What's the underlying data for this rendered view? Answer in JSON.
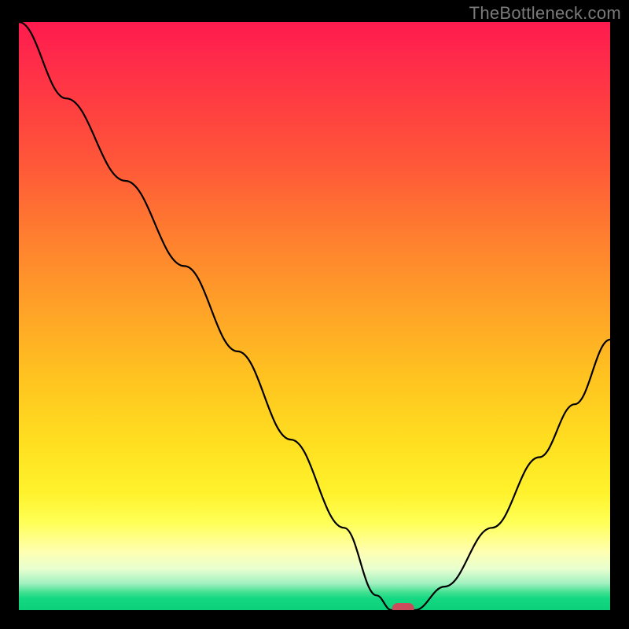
{
  "watermark": "TheBottleneck.com",
  "chart_data": {
    "type": "line",
    "title": "",
    "xlabel": "",
    "ylabel": "",
    "xlim": [
      0,
      100
    ],
    "ylim": [
      0,
      100
    ],
    "series": [
      {
        "name": "bottleneck-curve",
        "x": [
          0,
          8,
          18,
          28,
          37,
          46,
          55,
          60.5,
          63,
          67,
          72,
          80,
          88,
          94,
          100
        ],
        "y": [
          100,
          87,
          73,
          58.5,
          44,
          29,
          14,
          2.5,
          0,
          0,
          4,
          14,
          26,
          35,
          46
        ]
      }
    ],
    "marker": {
      "name": "optimum-marker",
      "x": 65,
      "y": 0,
      "color": "#cc4b5a"
    },
    "gradient_stops": [
      {
        "pos": 0.0,
        "color": "#ff1a4e"
      },
      {
        "pos": 0.35,
        "color": "#ff7a30"
      },
      {
        "pos": 0.72,
        "color": "#ffe020"
      },
      {
        "pos": 0.9,
        "color": "#ffffb0"
      },
      {
        "pos": 0.97,
        "color": "#40e090"
      },
      {
        "pos": 1.0,
        "color": "#0bd07a"
      }
    ]
  }
}
